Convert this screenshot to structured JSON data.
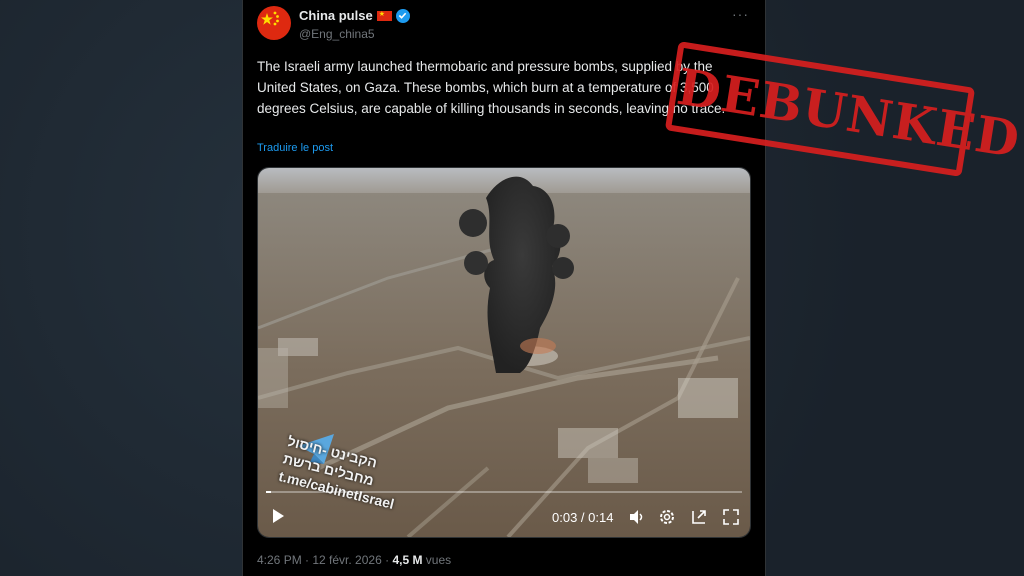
{
  "author": {
    "display_name": "China pulse",
    "handle": "@Eng_china5",
    "verified": true,
    "flag": "cn-flag"
  },
  "post": {
    "text": "The Israeli army launched thermobaric and pressure bombs, supplied by the United States, on Gaza. These bombs, which burn at a temperature of 3,500 degrees Celsius, are capable of killing thousands in seconds, leaving no trace.",
    "translate_link": "Traduire le post",
    "timestamp": "4:26 PM · 12 févr. 2026",
    "views_count": "4,5 M",
    "views_label": "vues"
  },
  "video": {
    "current_time": "0:03",
    "duration": "0:14",
    "time_separator": " / ",
    "progress": 0.01,
    "watermark_line1": "הקבינט -חיסול",
    "watermark_line2": "מחבלים ברשת",
    "watermark_line3": "t.me/cabinetIsrael"
  },
  "overlay": {
    "stamp_text": "DEBUNKED",
    "stamp_color": "#d61f1f"
  },
  "colors": {
    "accent": "#1d9bf0",
    "muted": "#71767b"
  }
}
